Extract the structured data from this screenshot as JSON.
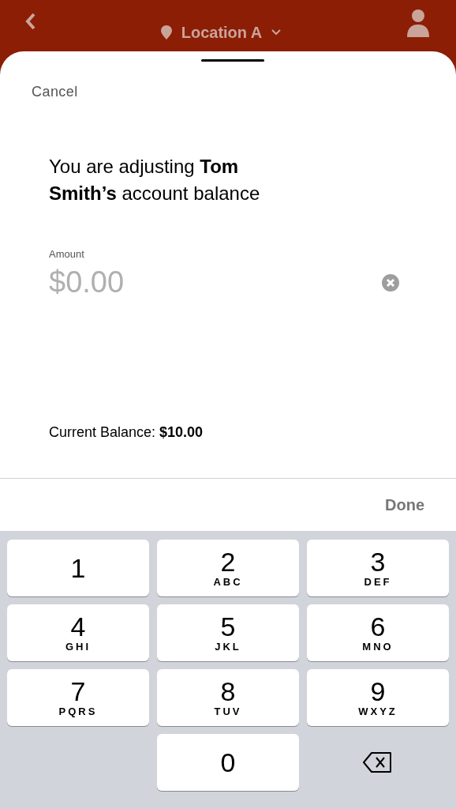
{
  "background_header": {
    "location": "Location A"
  },
  "sheet": {
    "cancel": "Cancel",
    "heading": "You are adjusting **Tom Smith’s** account balance",
    "amount_field": {
      "label": "Amount",
      "placeholder": "$0.00"
    },
    "current_balance": "Current Balance: **$10.00**"
  },
  "keyboard_toolbar": {
    "done": "Done"
  },
  "keys": [
    {
      "kind": "digit",
      "digit": "1"
    },
    {
      "kind": "digit",
      "digit": "2",
      "letters": "ABC"
    },
    {
      "kind": "digit",
      "digit": "3",
      "letters": "DEF"
    },
    {
      "kind": "digit",
      "digit": "4",
      "letters": "GHI"
    },
    {
      "kind": "digit",
      "digit": "5",
      "letters": "JKL"
    },
    {
      "kind": "digit",
      "digit": "6",
      "letters": "MNO"
    },
    {
      "kind": "digit",
      "digit": "7",
      "letters": "PQRS"
    },
    {
      "kind": "digit",
      "digit": "8",
      "letters": "TUV"
    },
    {
      "kind": "digit",
      "digit": "9",
      "letters": "WXYZ"
    },
    {
      "kind": "blank"
    },
    {
      "kind": "digit",
      "digit": "0"
    },
    {
      "kind": "delete"
    }
  ]
}
